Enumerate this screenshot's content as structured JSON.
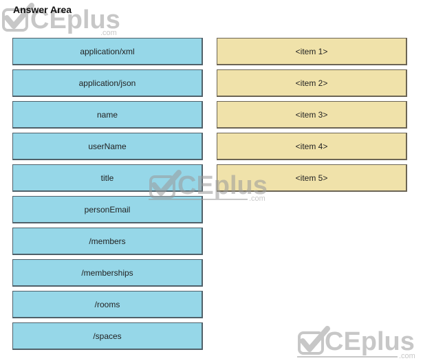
{
  "header": {
    "title": "Answer Area"
  },
  "source_items": [
    {
      "label": "application/xml"
    },
    {
      "label": "application/json"
    },
    {
      "label": "name"
    },
    {
      "label": "userName"
    },
    {
      "label": "title"
    },
    {
      "label": "personEmail"
    },
    {
      "label": "/members"
    },
    {
      "label": "/memberships"
    },
    {
      "label": "/rooms"
    },
    {
      "label": "/spaces"
    }
  ],
  "target_slots": [
    {
      "label": "<item 1>"
    },
    {
      "label": "<item 2>"
    },
    {
      "label": "<item 3>"
    },
    {
      "label": "<item 4>"
    },
    {
      "label": "<item 5>"
    }
  ],
  "watermark": {
    "brand": "CEplus",
    "suffix": ".com",
    "icon": "checkmark-icon"
  },
  "colors": {
    "source_fill": "#96d7e8",
    "target_fill": "#f0e2aa",
    "watermark": "#9a9a9a"
  }
}
